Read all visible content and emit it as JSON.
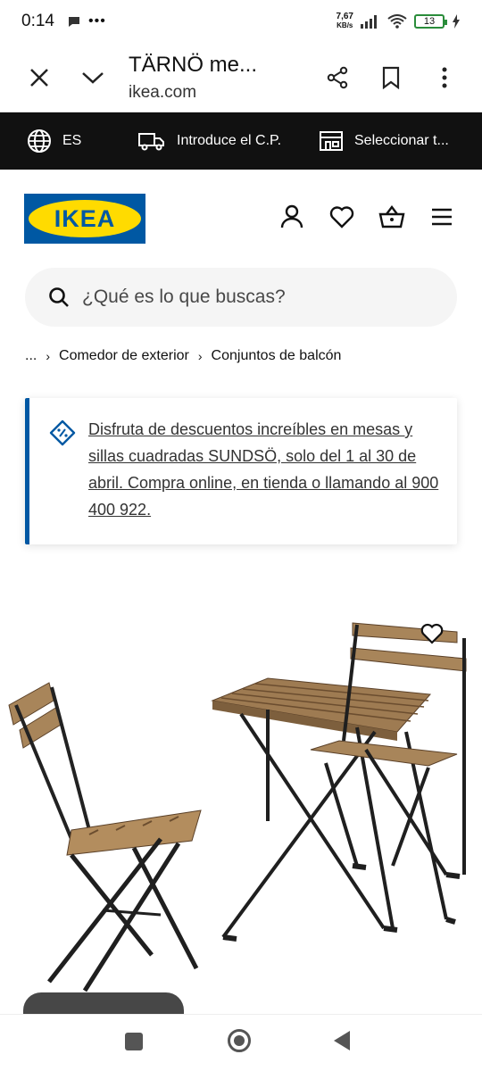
{
  "status": {
    "time": "0:14",
    "net_speed_value": "7,67",
    "net_speed_unit": "KB/s",
    "battery": "13"
  },
  "browser": {
    "page_title": "TÄRNÖ me...",
    "url": "ikea.com"
  },
  "util": {
    "language": "ES",
    "postcode": "Introduce el C.P.",
    "store": "Seleccionar t..."
  },
  "logo_text": "IKEA",
  "search": {
    "placeholder": "¿Qué es lo que buscas?"
  },
  "breadcrumb": {
    "ellipsis": "...",
    "sep": "›",
    "item1": "Comedor de exterior",
    "item2": "Conjuntos de balcón"
  },
  "promo": {
    "text": "Disfruta de descuentos increíbles en mesas y sillas cuadradas SUNDSÖ, solo del 1 al 30 de abril. Compra online, en tienda o llamando al 900 400 922."
  },
  "colors": {
    "brand_blue": "#0058a3",
    "brand_yellow": "#ffdb00",
    "util_bg": "#111111"
  },
  "icons": [
    "close-icon",
    "chevron-down-icon",
    "share-icon",
    "bookmark-icon",
    "more-vert-icon",
    "globe-icon",
    "truck-icon",
    "store-icon",
    "user-icon",
    "heart-icon",
    "basket-icon",
    "menu-icon",
    "search-icon",
    "discount-tag-icon"
  ]
}
